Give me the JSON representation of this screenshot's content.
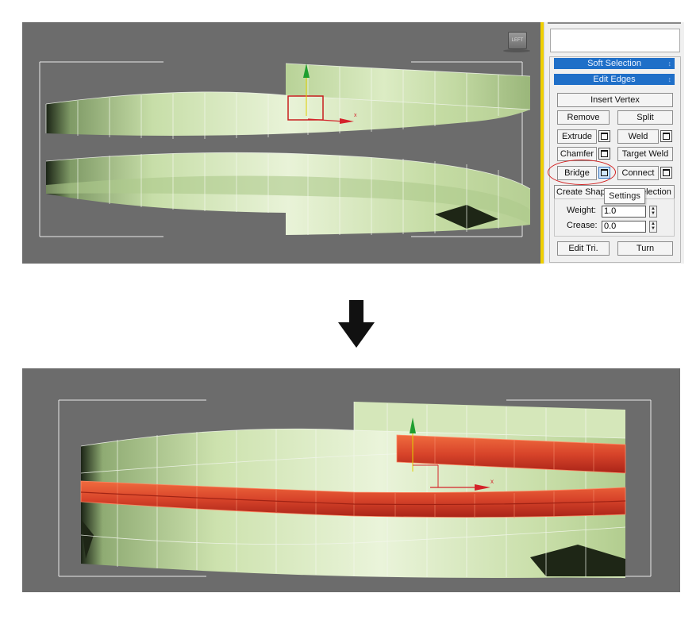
{
  "panel": {
    "rollouts": {
      "soft_selection": "Soft Selection",
      "edit_edges": "Edit Edges",
      "collapse_symbol": "−"
    },
    "buttons": {
      "insert_vertex": "Insert Vertex",
      "remove": "Remove",
      "split": "Split",
      "extrude": "Extrude",
      "weld": "Weld",
      "chamfer": "Chamfer",
      "target_weld": "Target Weld",
      "bridge": "Bridge",
      "connect": "Connect",
      "create_shape": "Create Shape From Selection",
      "edit_tri": "Edit Tri.",
      "turn": "Turn"
    },
    "fields": {
      "weight_label": "Weight:",
      "weight_value": "1.0",
      "crease_label": "Crease:",
      "crease_value": "0.0"
    },
    "tooltip": "Settings"
  },
  "viewport_top": {
    "view_cube_label": "LEFT",
    "axis_x_label": "x"
  },
  "viewport_bottom": {
    "axis_x_label": "x"
  },
  "colors": {
    "viewport_bg": "#6c6c6c",
    "mesh_green": "#d9ebbf",
    "selection_red": "#e4552b",
    "rollout_blue": "#1f6fc8",
    "highlight_red": "#d21f1f",
    "gizmo_green": "#1f9e2f",
    "gizmo_red": "#d4232a",
    "gizmo_yellow": "#e0d000"
  }
}
